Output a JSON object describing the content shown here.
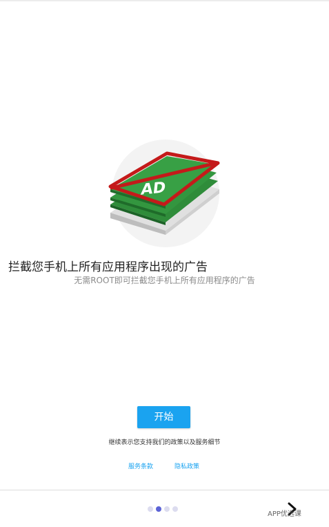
{
  "screen": {
    "headline": "拦截您手机上所有应用程序出现的广告",
    "subline": "无需ROOT即可拦截您手机上所有应用程序的广告"
  },
  "illustration": {
    "ad_label": "AD",
    "colors": {
      "card_green": "#2e8b3a",
      "card_green_dark": "#1f6b2a",
      "card_gray": "#d8d8d8",
      "strike_red": "#c41a1a",
      "halo": "#f1f1f1"
    }
  },
  "actions": {
    "start_label": "开始",
    "agreement_text": "继续表示您支持我们的政策以及服务细节",
    "terms_label": "服务条款",
    "privacy_label": "隐私政策"
  },
  "pager": {
    "total": 4,
    "active_index": 1
  },
  "watermark": {
    "text": "APP优选课"
  },
  "theme": {
    "accent": "#1aa3f0",
    "pager_active": "#5b63d6",
    "pager_inactive": "#dcdcef"
  }
}
